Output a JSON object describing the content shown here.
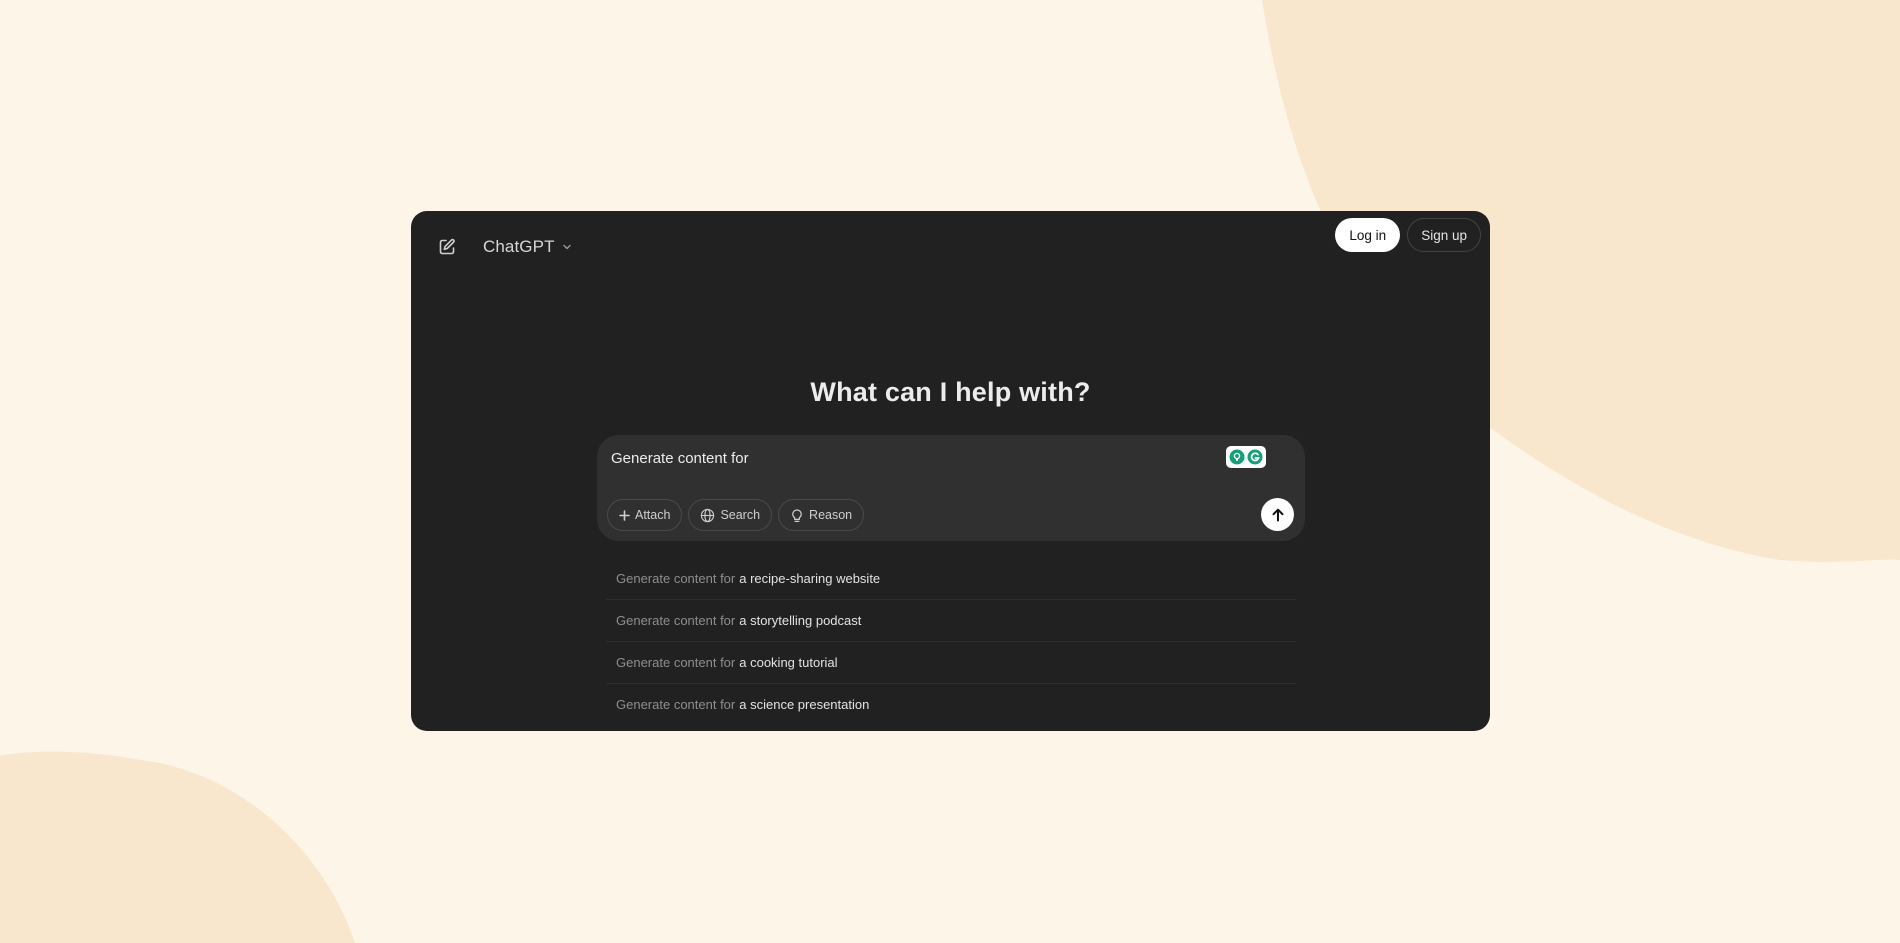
{
  "colors": {
    "page_background": "#fdf5e8",
    "blob": "#f8e6cd",
    "window_background": "#212121",
    "composer_background": "#303030",
    "grammarly_green": "#15a07a"
  },
  "header": {
    "new_chat_icon": "edit-icon",
    "model_name": "ChatGPT",
    "model_dropdown_icon": "chevron-down-icon",
    "login_label": "Log in",
    "signup_label": "Sign up"
  },
  "main": {
    "heading": "What can I help with?"
  },
  "composer": {
    "input_value": "Generate content for",
    "grammarly_icon": "grammarly-icon",
    "tools": [
      {
        "label": "Attach",
        "icon": "plus-icon"
      },
      {
        "label": "Search",
        "icon": "globe-icon"
      },
      {
        "label": "Reason",
        "icon": "lightbulb-icon"
      }
    ],
    "send_icon": "arrow-up-icon"
  },
  "suggestions": [
    {
      "prefix": "Generate content for",
      "topic": "a recipe-sharing website"
    },
    {
      "prefix": "Generate content for",
      "topic": "a storytelling podcast"
    },
    {
      "prefix": "Generate content for",
      "topic": "a cooking tutorial"
    },
    {
      "prefix": "Generate content for",
      "topic": "a science presentation"
    }
  ]
}
